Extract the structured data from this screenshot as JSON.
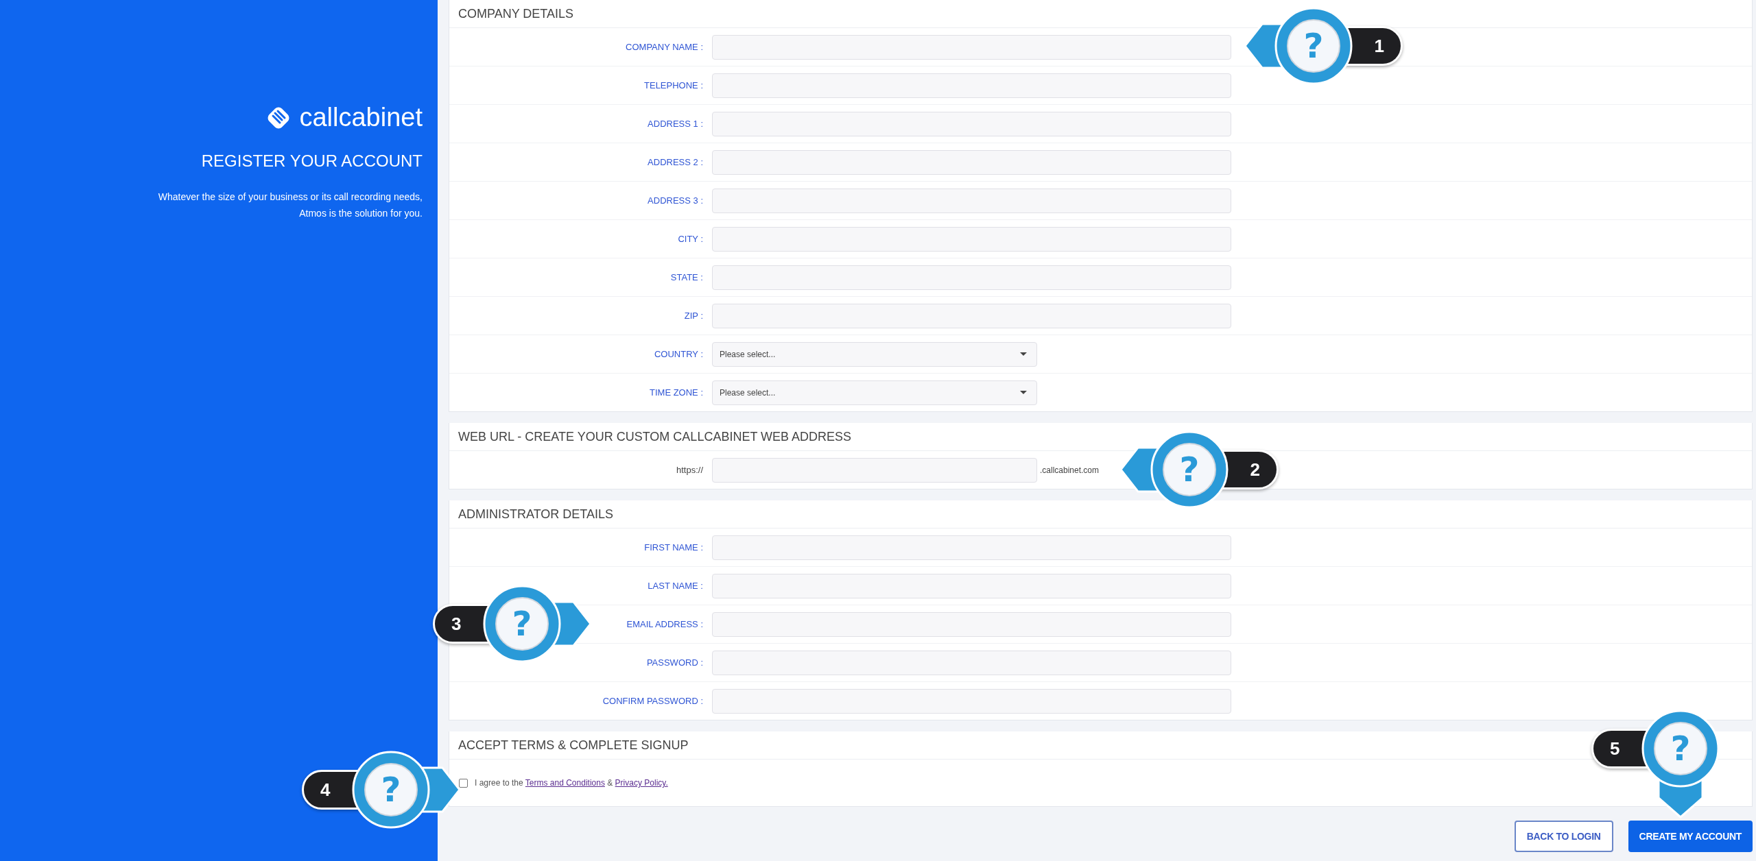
{
  "brand": {
    "logo_text": "callcabinet",
    "heading": "REGISTER YOUR ACCOUNT",
    "description_lines": [
      "Whatever the size of your business or its call recording needs,",
      "Atmos is the solution for you."
    ]
  },
  "sections": [
    {
      "kind": "fields",
      "title": "COMPANY DETAILS",
      "fields": [
        {
          "kind": "text",
          "label": "COMPANY NAME :"
        },
        {
          "kind": "text",
          "label": "TELEPHONE :"
        },
        {
          "kind": "text",
          "label": "ADDRESS 1 :"
        },
        {
          "kind": "text",
          "label": "ADDRESS 2 :"
        },
        {
          "kind": "text",
          "label": "ADDRESS 3 :"
        },
        {
          "kind": "text",
          "label": "CITY :"
        },
        {
          "kind": "text",
          "label": "STATE :"
        },
        {
          "kind": "text",
          "label": "ZIP :"
        },
        {
          "kind": "select",
          "label": "COUNTRY :",
          "value": "Please select..."
        },
        {
          "kind": "select",
          "label": "TIME ZONE :",
          "value": "Please select..."
        }
      ]
    },
    {
      "kind": "url",
      "title": "WEB URL - CREATE YOUR CUSTOM CALLCABINET WEB ADDRESS",
      "prefix": "https://",
      "suffix": ".callcabinet.com"
    },
    {
      "kind": "fields",
      "title": "ADMINISTRATOR DETAILS",
      "fields": [
        {
          "kind": "text",
          "label": "FIRST NAME :"
        },
        {
          "kind": "text",
          "label": "LAST NAME :"
        },
        {
          "kind": "text",
          "label": "EMAIL ADDRESS :"
        },
        {
          "kind": "text",
          "label": "PASSWORD :"
        },
        {
          "kind": "text",
          "label": "CONFIRM PASSWORD :"
        }
      ]
    },
    {
      "kind": "terms",
      "title": "ACCEPT TERMS & COMPLETE SIGNUP",
      "checked": false,
      "parts": [
        {
          "kind": "text",
          "text": "I agree to the"
        },
        {
          "kind": "link",
          "text": "Terms and Conditions"
        },
        {
          "kind": "text",
          "text": "&"
        },
        {
          "kind": "link",
          "text": "Privacy Policy."
        }
      ]
    }
  ],
  "buttons": [
    {
      "kind": "secondary",
      "label": "BACK TO LOGIN"
    },
    {
      "kind": "primary",
      "label": "CREATE MY ACCOUNT"
    }
  ],
  "callouts": [
    {
      "number": "1",
      "symbol": "?",
      "kind": "left"
    },
    {
      "number": "2",
      "symbol": "?",
      "kind": "left"
    },
    {
      "number": "3",
      "symbol": "?",
      "kind": "right"
    },
    {
      "number": "4",
      "symbol": "?",
      "kind": "right"
    },
    {
      "number": "5",
      "symbol": "?",
      "kind": "down"
    }
  ]
}
